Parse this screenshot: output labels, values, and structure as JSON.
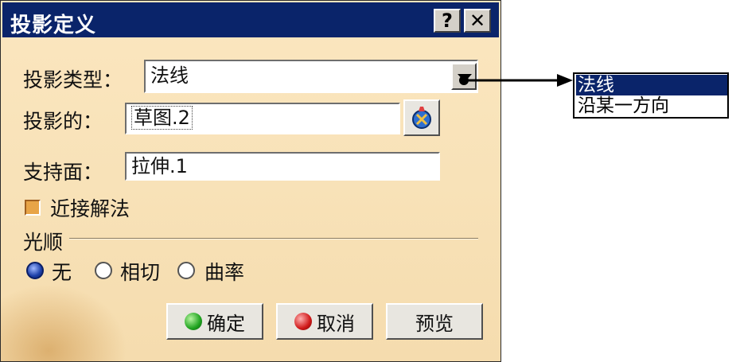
{
  "dialog": {
    "title": "投影定义",
    "help_label": "?",
    "close_label": "✕",
    "projection_type_label": "投影类型：",
    "projection_type_value": "法线",
    "projected_label": "投影的：",
    "projected_value": "草图.2",
    "support_label": "支持面：",
    "support_value": "拉伸.1",
    "nearest_solution_label": "近接解法",
    "smoothing_group_label": "光顺",
    "smoothing_options": [
      {
        "label": "无",
        "selected": true
      },
      {
        "label": "相切",
        "selected": false
      },
      {
        "label": "曲率",
        "selected": false
      }
    ],
    "ok_label": "确定",
    "cancel_label": "取消",
    "preview_label": "预览"
  },
  "dropdown": {
    "options": [
      "法线",
      "沿某一方向"
    ],
    "selected_index": 0
  },
  "colors": {
    "titlebar": "#0a246a",
    "dialog_bg": "#f8e2b8",
    "ok_icon": "#1fa31f",
    "cancel_icon": "#d01818"
  },
  "icons": {
    "element_select": "sketch-select-icon"
  }
}
